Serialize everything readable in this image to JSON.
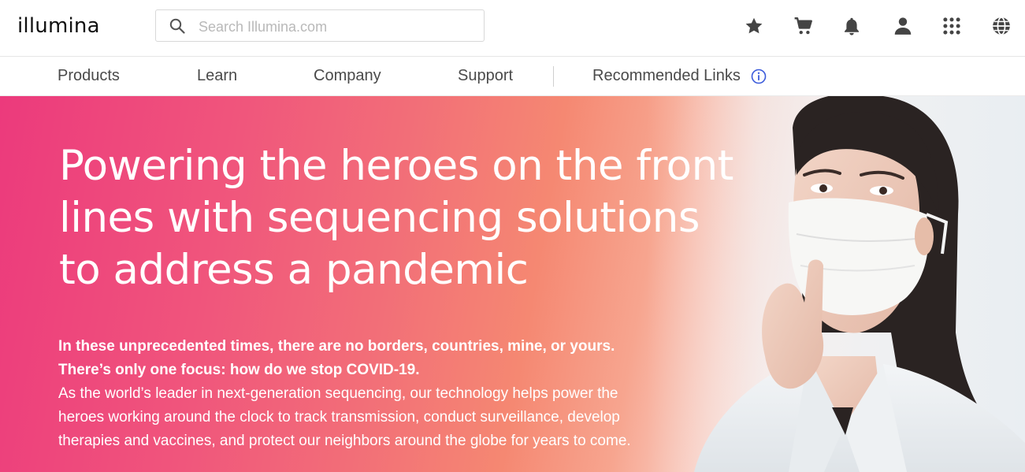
{
  "header": {
    "logo_text": "illumina",
    "search": {
      "placeholder": "Search Illumina.com",
      "value": "",
      "icon": "search-icon"
    },
    "icons": [
      "star-icon",
      "cart-icon",
      "bell-icon",
      "user-icon",
      "apps-grid-icon",
      "globe-icon"
    ]
  },
  "nav": {
    "items": [
      {
        "label": "Products"
      },
      {
        "label": "Learn"
      },
      {
        "label": "Company"
      },
      {
        "label": "Support"
      },
      {
        "label": "Recommended Links"
      }
    ],
    "info_icon": "info-icon"
  },
  "hero": {
    "headline_lines": [
      "Powering the heroes on the front",
      "lines with sequencing solutions",
      "to address a pandemic"
    ],
    "bold_lines": [
      "In these unprecedented times, there are no borders, countries, mine, or yours.",
      "There’s only one focus: how do we stop COVID-19."
    ],
    "body_lines": [
      "As the world’s leader in next-generation sequencing, our technology helps power the",
      "heroes working around the clock to track transmission, conduct surveillance, develop",
      "therapies and vaccines, and protect our neighbors around the globe for years to come."
    ]
  },
  "colors": {
    "hero_gradient_start": "#ec3a7c",
    "hero_gradient_mid": "#f58872",
    "icon_color": "#444444",
    "info_icon_color": "#3b5bdb",
    "nav_text": "#4a4a4a"
  }
}
